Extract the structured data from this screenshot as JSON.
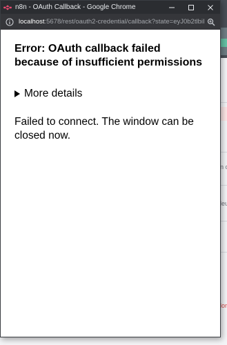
{
  "window": {
    "title": "n8n - OAuth Callback - Google Chrome"
  },
  "address_bar": {
    "host": "localhost",
    "path": ":5678/rest/oauth2-credential/callback?state=eyJ0b2tlbiI6..."
  },
  "page": {
    "heading": "Error: OAuth callback failed because of insufficient permissions",
    "details_label": "More details",
    "message": "Failed to connect. The window can be closed now."
  },
  "background_app": {
    "fragment_1": "n ca",
    "fragment_2": "leu",
    "fragment_3": "lor",
    "fragment_4": "O"
  },
  "colors": {
    "titlebar": "#2b2d31",
    "addressbar": "#35363a",
    "n8n_brand": "#ea4b71"
  }
}
